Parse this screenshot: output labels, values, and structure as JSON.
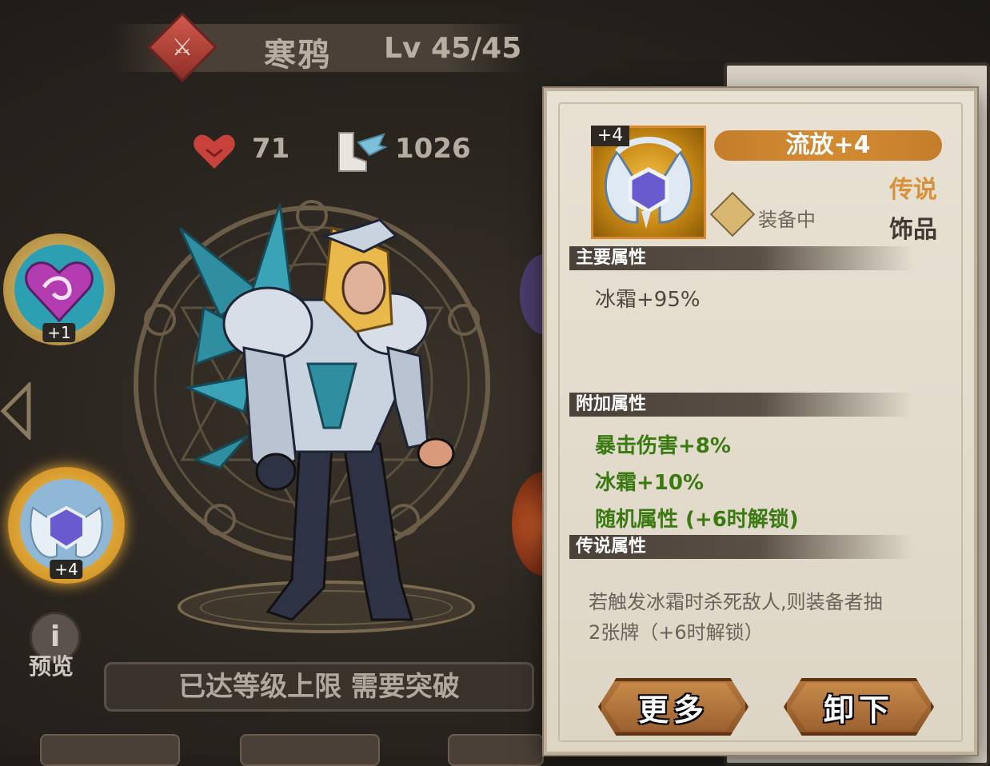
{
  "hero": {
    "name": "寒鸦",
    "level": "Lv 45/45",
    "class_icon": "sword-icon"
  },
  "stats": {
    "hp_value": "71",
    "speed_value": "1026"
  },
  "slots": {
    "slot1_badge": "+1",
    "slot2_badge": "+4"
  },
  "preview_label": "预览",
  "level_cap_message": "已达等级上限 需要突破",
  "item": {
    "plus_badge": "+4",
    "name": "流放+4",
    "rarity": "传说",
    "type": "饰品",
    "equipped_label": "装备中",
    "sections": {
      "main": "主要属性",
      "extra": "附加属性",
      "legend": "传说属性"
    },
    "main_attrs": [
      "冰霜+95%"
    ],
    "extra_attrs": [
      "暴击伤害+8%",
      "冰霜+10%",
      "随机属性 (+6时解锁)"
    ],
    "legend_text_1": "若触发冰霜时杀死敌人,则装备者抽",
    "legend_text_2": "2张牌（+6时解锁）"
  },
  "buttons": {
    "more": "更多",
    "unequip": "卸下"
  },
  "colors": {
    "rarity_legend": "#d7913a",
    "extra_attr_green": "#3b7a12",
    "name_bar_orange": "#c47d2b"
  }
}
